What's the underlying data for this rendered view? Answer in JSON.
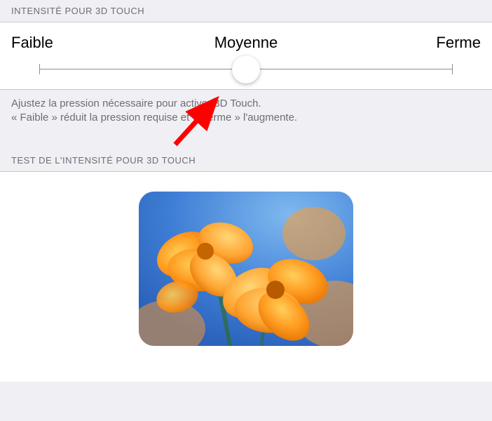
{
  "sections": {
    "intensity_header": "INTENSITÉ POUR 3D TOUCH",
    "test_header": "TEST DE L'INTENSITÉ POUR 3D TOUCH"
  },
  "slider": {
    "label_low": "Faible",
    "label_mid": "Moyenne",
    "label_high": "Ferme",
    "position": "middle"
  },
  "footer": {
    "line1": "Ajustez la pression nécessaire pour activer 3D Touch.",
    "line2": "« Faible » réduit la pression requise et « Ferme » l'augmente."
  },
  "annotation": {
    "arrow_color": "#ff0000"
  }
}
